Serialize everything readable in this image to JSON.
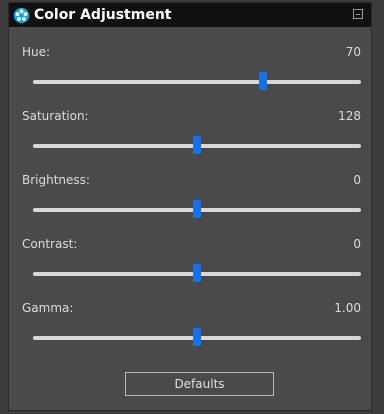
{
  "panel": {
    "title": "Color Adjustment"
  },
  "sliders": [
    {
      "label": "Hue:",
      "value_text": "70",
      "position": 0.7
    },
    {
      "label": "Saturation:",
      "value_text": "128",
      "position": 0.5
    },
    {
      "label": "Brightness:",
      "value_text": "0",
      "position": 0.5
    },
    {
      "label": "Contrast:",
      "value_text": "0",
      "position": 0.5
    },
    {
      "label": "Gamma:",
      "value_text": "1.00",
      "position": 0.5
    }
  ],
  "buttons": {
    "defaults_label": "Defaults"
  },
  "colors": {
    "accent": "#1473e6",
    "title_bg": "#111111",
    "panel_bg": "#4a4a4a"
  },
  "icons": {
    "app": "color-wheel-icon",
    "collapse": "collapse-icon"
  }
}
